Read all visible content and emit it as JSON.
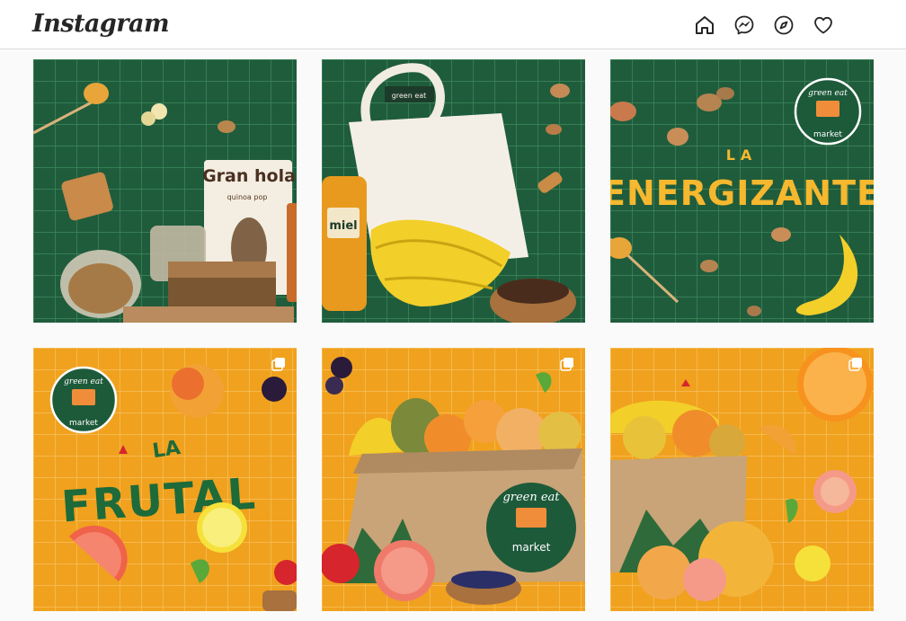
{
  "header": {
    "logo_text": "Instagram",
    "nav_icons": [
      "home-icon",
      "messenger-icon",
      "explore-icon",
      "activity-heart-icon"
    ]
  },
  "posts": [
    {
      "theme": "green",
      "bg_color": "#1f5c3c",
      "product_box_brand": "Gran hola",
      "product_box_sub": "quinoa pop",
      "multi": false
    },
    {
      "theme": "green",
      "bg_color": "#1f5c3c",
      "bag_label": "green eat",
      "jar_label": "miel",
      "multi": false
    },
    {
      "theme": "green",
      "bg_color": "#1f5c3c",
      "title_top": "LA",
      "title_main": "ENERGIZANTE",
      "badge_top": "green eat",
      "badge_bottom": "market",
      "multi": false
    },
    {
      "theme": "orange",
      "bg_color": "#f0a11e",
      "title_top": "LA",
      "title_main": "FRUTAL",
      "badge_top": "green eat",
      "badge_bottom": "market",
      "multi": true
    },
    {
      "theme": "orange",
      "bg_color": "#f0a11e",
      "badge_top": "green eat",
      "badge_bottom": "market",
      "multi": true
    },
    {
      "theme": "orange",
      "bg_color": "#f0a11e",
      "multi": true
    }
  ],
  "colors": {
    "green_bg": "#1f5c3c",
    "orange_bg": "#f0a11e",
    "accent_yellow": "#f5b82e",
    "brand_green": "#1d5a3a"
  }
}
